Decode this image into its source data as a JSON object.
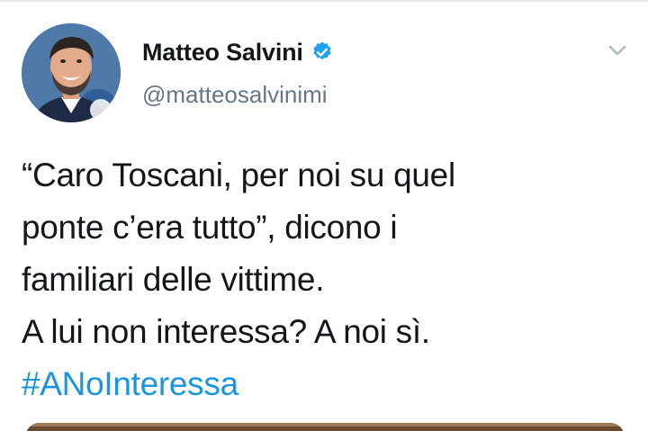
{
  "tweet": {
    "author": {
      "display_name": "Matteo Salvini",
      "handle": "@matteosalvinimi",
      "verified": true
    },
    "text_lines": [
      "“Caro Toscani, per noi su quel",
      "ponte c’era tutto”, dicono i",
      "familiari delle vittime.",
      "A lui non interessa? A noi sì."
    ],
    "hashtag": "#ANoInteressa",
    "icons": {
      "verified": "verified-badge-icon",
      "menu": "chevron-down-icon"
    },
    "colors": {
      "text": "#14171a",
      "secondary": "#657786",
      "link": "#1b95e0",
      "verified": "#1da1f2"
    }
  }
}
